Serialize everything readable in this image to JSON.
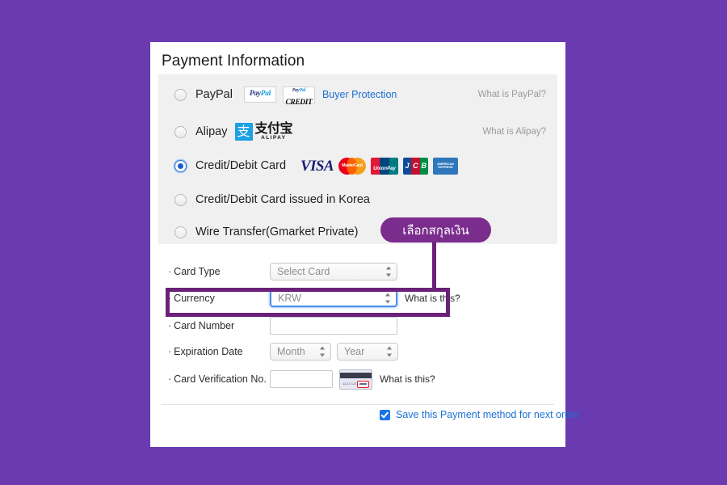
{
  "page": {
    "background_color": "#6a3ab0",
    "card_background": "#ffffff"
  },
  "header": {
    "title": "Payment Information"
  },
  "payment_methods": [
    {
      "id": "paypal",
      "label": "PayPal",
      "selected": false,
      "logos": [
        "PayPal",
        "PayPal CREDIT"
      ],
      "paypal_pal": "Pay",
      "paypal_pal2": "Pal",
      "credit_word": "CREDIT",
      "link_text": "Buyer Protection",
      "right_link": "What is PayPal?"
    },
    {
      "id": "alipay",
      "label": "Alipay",
      "selected": false,
      "logo_mark": "支",
      "logo_hanzi": "支付宝",
      "logo_latin": "ALIPAY",
      "right_link": "What is Alipay?"
    },
    {
      "id": "credit-debit-card",
      "label": "Credit/Debit Card",
      "selected": true,
      "brands": [
        "VISA",
        "MasterCard",
        "UnionPay",
        "JCB",
        "American Express"
      ],
      "visa_text": "VISA",
      "mastercard_text": "MasterCard",
      "unionpay_text": "UnionPay",
      "jcb_j": "J",
      "jcb_c": "C",
      "jcb_b": "B",
      "amex_text": "AMERICAN EXPRESS",
      "right_link": ""
    },
    {
      "id": "credit-debit-card-korea",
      "label": "Credit/Debit Card issued in Korea",
      "selected": false,
      "right_link": ""
    },
    {
      "id": "wire-transfer",
      "label": "Wire Transfer(Gmarket Private)",
      "selected": false,
      "right_link": ""
    }
  ],
  "form": {
    "bullet": "·",
    "rows": [
      {
        "label": "Card Type",
        "control": "select",
        "value": "Select Card",
        "helper": ""
      },
      {
        "label": "Currency",
        "control": "select",
        "value": "KRW",
        "helper": "What is this?",
        "focused": true,
        "highlighted": true
      },
      {
        "label": "Card Number",
        "control": "text",
        "value": "",
        "placeholder": ""
      },
      {
        "label": "Expiration Date",
        "control": "select-pair",
        "month_value": "Month",
        "year_value": "Year"
      },
      {
        "label": "Card Verification No.",
        "control": "text",
        "value": "",
        "helper": "What is this?",
        "icon_digits": "1121 1212"
      }
    ]
  },
  "save_option": {
    "checked": true,
    "label": "Save this Payment method for next order",
    "color": "#1a6fd4"
  },
  "annotation": {
    "callout_label": "เลือกสกุลเงิน",
    "callout_color": "#7b2d8e",
    "highlight_color": "#6b2179",
    "target_field": "Currency"
  }
}
